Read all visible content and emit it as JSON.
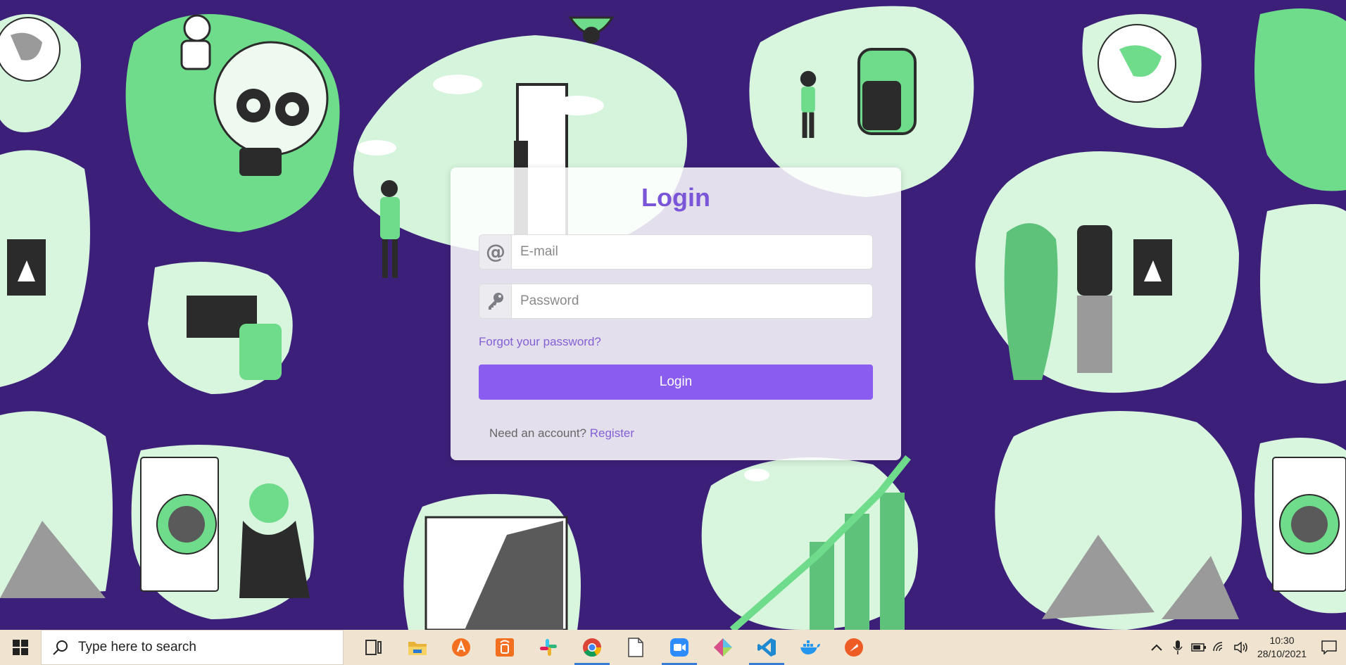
{
  "login": {
    "title": "Login",
    "email_placeholder": "E-mail",
    "email_value": "",
    "password_placeholder": "Password",
    "password_value": "",
    "forgot_label": "Forgot your password?",
    "submit_label": "Login",
    "register_prompt": "Need an account?",
    "register_link": "Register"
  },
  "taskbar": {
    "search_placeholder": "Type here to search",
    "apps": [
      "task-view",
      "file-explorer",
      "avast",
      "remote-app",
      "slack",
      "chrome",
      "notepad",
      "zoom",
      "git-kraken",
      "vscode",
      "docker",
      "postman"
    ],
    "active_apps": [
      "chrome",
      "zoom",
      "vscode"
    ],
    "time": "10:30",
    "date": "28/10/2021"
  },
  "colors": {
    "background": "#3c1f78",
    "accent": "#8b5cf0",
    "title": "#7a55d8",
    "illustration_green": "#6fdc8c"
  }
}
